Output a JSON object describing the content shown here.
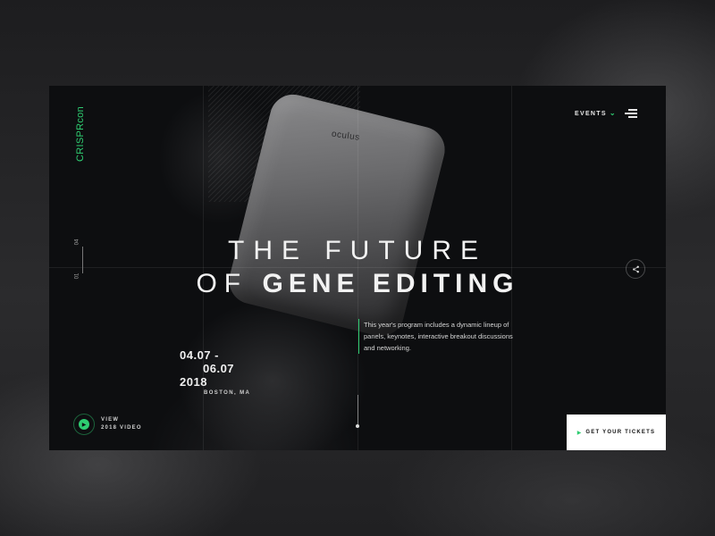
{
  "brand": {
    "name_main": "CRISPR",
    "name_sub": "con"
  },
  "pager": {
    "current": "01",
    "total": "04"
  },
  "nav": {
    "events_label": "EVENTS",
    "menu_icon": "hamburger-menu-icon"
  },
  "headset": {
    "brand": "oculus"
  },
  "hero": {
    "line1": "THE FUTURE",
    "line2_light": "OF",
    "line2_bold": "GENE EDITING"
  },
  "description": "This year's program includes a dynamic lineup of panels, keynotes, interactive breakout discussions and networking.",
  "event": {
    "date_line1": "04.07 -",
    "date_line2": "06.07",
    "year": "2018",
    "location": "BOSTON, MA"
  },
  "video": {
    "line1": "VIEW",
    "line2": "2018 VIDEO"
  },
  "cta": {
    "label": "GET YOUR TICKETS"
  },
  "colors": {
    "accent": "#2ecc71",
    "card_bg": "#0d0e10",
    "cta_bg": "#ffffff"
  }
}
